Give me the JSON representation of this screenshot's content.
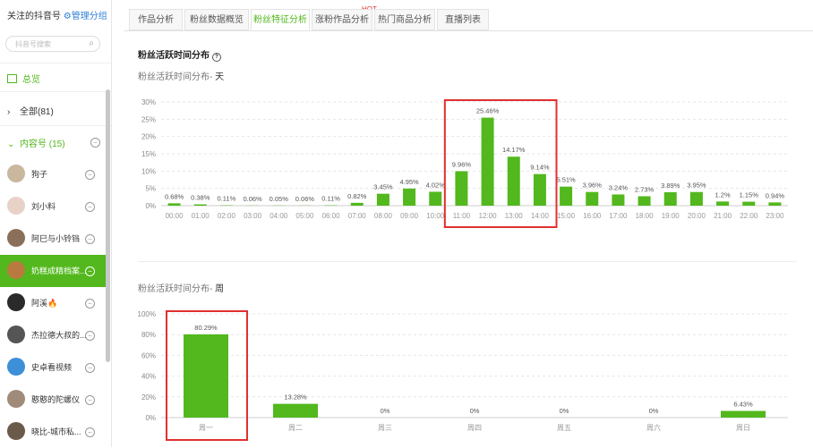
{
  "sidebar": {
    "header_title": "关注的抖音号",
    "header_link": "管理分组",
    "search_placeholder": "抖音号搜索",
    "overview_label": "总览",
    "group_all": "全部(81)",
    "group_content": "内容号 (15)",
    "accounts": [
      {
        "name": "狗子",
        "avatar_color": "#c9b79e"
      },
      {
        "name": "刘小料",
        "avatar_color": "#e8d2c8"
      },
      {
        "name": "阿巳与小铃铛",
        "avatar_color": "#8a6f5a"
      },
      {
        "name": "奶糕成精档案...",
        "avatar_color": "#b97a3f",
        "active": true
      },
      {
        "name": "阿溪🔥",
        "avatar_color": "#2a2a2a"
      },
      {
        "name": "杰拉德大叔的...",
        "avatar_color": "#555555"
      },
      {
        "name": "史卓看视频",
        "avatar_color": "#3d8fd8"
      },
      {
        "name": "憨憨的陀螺仪",
        "avatar_color": "#a08a7a"
      },
      {
        "name": "晓比-城市私...",
        "avatar_color": "#6b5a4a"
      }
    ]
  },
  "tabs": [
    {
      "label": "作品分析"
    },
    {
      "label": "粉丝数据概览"
    },
    {
      "label": "粉丝特征分析",
      "active": true
    },
    {
      "label": "涨粉作品分析"
    },
    {
      "label": "热门商品分析"
    },
    {
      "label": "直播列表"
    }
  ],
  "hot_badge": "HOT",
  "section_title": "粉丝活跃时间分布",
  "help_icon": "?",
  "subtitle_prefix": "粉丝活跃时间分布-",
  "subtitle_day": "天",
  "subtitle_week": "周",
  "colors": {
    "accent": "#52b81d",
    "highlight": "#e03030"
  },
  "chart_data": [
    {
      "type": "bar",
      "categories": [
        "00:00",
        "01:00",
        "02:00",
        "03:00",
        "04:00",
        "05:00",
        "06:00",
        "07:00",
        "08:00",
        "09:00",
        "10:00",
        "11:00",
        "12:00",
        "13:00",
        "14:00",
        "15:00",
        "16:00",
        "17:00",
        "18:00",
        "19:00",
        "20:00",
        "21:00",
        "22:00",
        "23:00"
      ],
      "values": [
        0.68,
        0.38,
        0.11,
        0.06,
        0.05,
        0.06,
        0.11,
        0.82,
        3.45,
        4.95,
        4.02,
        9.96,
        25.46,
        14.17,
        9.14,
        5.51,
        3.96,
        3.24,
        2.73,
        3.89,
        3.95,
        1.2,
        1.15,
        0.94
      ],
      "labels": [
        "0.68%",
        "0.38%",
        "0.11%",
        "0.06%",
        "0.05%",
        "0.06%",
        "0.11%",
        "0.82%",
        "3.45%",
        "4.95%",
        "4.02%",
        "9.96%",
        "25.46%",
        "14.17%",
        "9.14%",
        "5.51%",
        "3.96%",
        "3.24%",
        "2.73%",
        "3.89%",
        "3.95%",
        "1.2%",
        "1.15%",
        "0.94%"
      ],
      "yticks": [
        "0%",
        "5%",
        "10%",
        "15%",
        "20%",
        "25%",
        "30%"
      ],
      "ylim": [
        0,
        30
      ]
    },
    {
      "type": "bar",
      "categories": [
        "周一",
        "周二",
        "周三",
        "周四",
        "周五",
        "周六",
        "周日"
      ],
      "values": [
        80.29,
        13.28,
        0,
        0,
        0,
        0,
        6.43
      ],
      "labels": [
        "80.29%",
        "13.28%",
        "0%",
        "0%",
        "0%",
        "0%",
        "6.43%"
      ],
      "yticks": [
        "0%",
        "20%",
        "40%",
        "60%",
        "80%",
        "100%"
      ],
      "ylim": [
        0,
        100
      ]
    }
  ]
}
